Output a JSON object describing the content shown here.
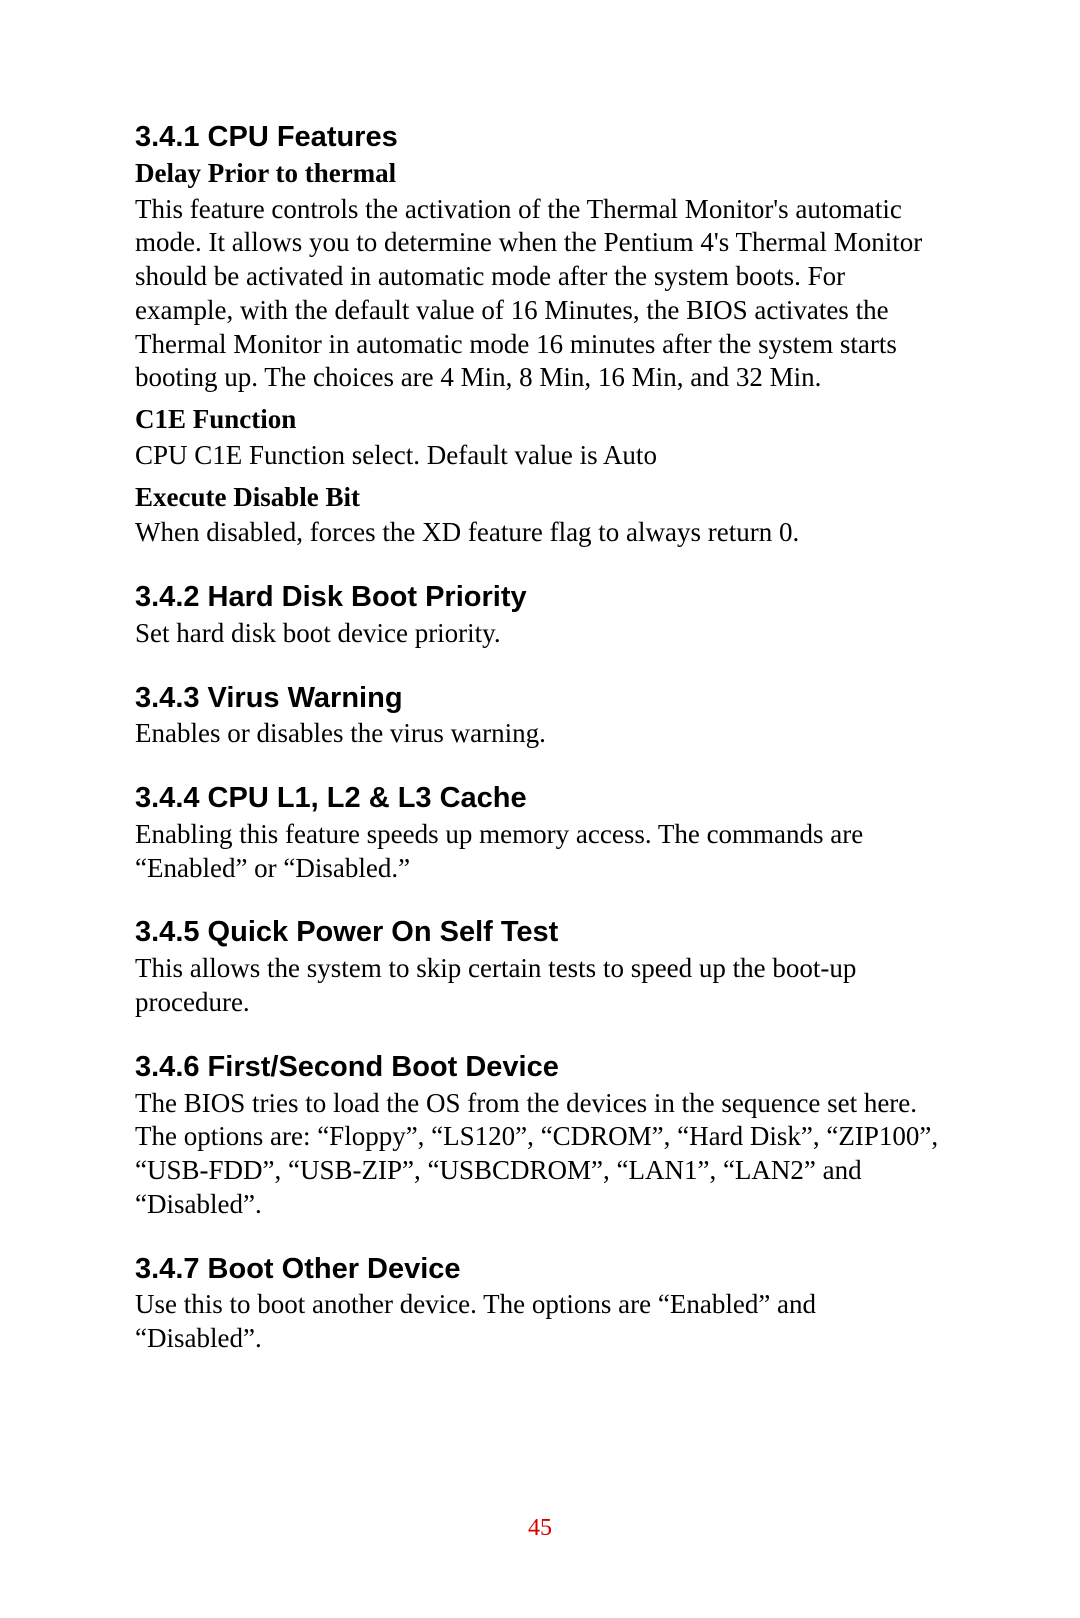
{
  "sections": {
    "s1": {
      "heading": "3.4.1 CPU Features",
      "sub1": {
        "title": "Delay Prior to thermal",
        "body": "This feature controls the activation of the Thermal Monitor's automatic mode. It allows you to determine when the Pentium 4's Thermal Monitor should be activated in automatic mode after the system boots. For example, with the default value of 16 Minutes, the BIOS activates the Thermal Monitor in automatic mode 16 minutes after the system starts booting up. The choices are 4 Min, 8 Min, 16 Min, and 32 Min."
      },
      "sub2": {
        "title": "C1E Function",
        "body": "CPU C1E Function select. Default value is Auto"
      },
      "sub3": {
        "title": "Execute Disable Bit",
        "body": "When disabled, forces the XD feature flag to always return 0."
      }
    },
    "s2": {
      "heading": "3.4.2 Hard Disk Boot Priority",
      "body": "Set hard disk boot device priority."
    },
    "s3": {
      "heading": "3.4.3 Virus Warning",
      "body": "Enables or disables the virus warning."
    },
    "s4": {
      "heading": "3.4.4 CPU L1, L2 & L3 Cache",
      "body": "Enabling this feature speeds up memory access. The commands are “Enabled” or “Disabled.”"
    },
    "s5": {
      "heading": "3.4.5 Quick Power On Self Test",
      "body": "This allows the system to skip certain tests to speed up the boot-up procedure."
    },
    "s6": {
      "heading": "3.4.6 First/Second Boot Device",
      "body": "The BIOS tries to load the OS from the devices in the sequence set here. The options are: “Floppy”, “LS120”, “CDROM”, “Hard Disk”, “ZIP100”, “USB-FDD”, “USB-ZIP”, “USBCDROM”, “LAN1”, “LAN2” and “Disabled”."
    },
    "s7": {
      "heading": "3.4.7 Boot Other Device",
      "body": "Use this to boot another device. The options are “Enabled” and “Disabled”."
    }
  },
  "page_number": "45"
}
